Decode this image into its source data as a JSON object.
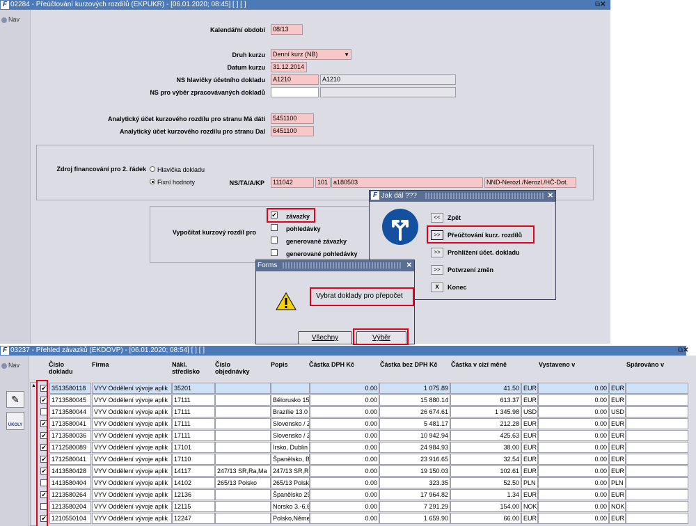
{
  "top_window": {
    "title": "02284 - Přeúčtování kurzových rozdílů (EKPUKR) - [06.01.2020; 08:45]  [ ]  [ ]",
    "nav": "Nav",
    "fields": {
      "kalendarni_obdobi_label": "Kalendářní období",
      "kalendarni_obdobi": "08/13",
      "druh_kurzu_label": "Druh kurzu",
      "druh_kurzu": "Denní kurz (NB)",
      "datum_kurzu_label": "Datum kurzu",
      "datum_kurzu": "31.12.2014",
      "ns_hlavicky_label": "NS hlavičky účetního dokladu",
      "ns_hlavicky_code": "A1210",
      "ns_hlavicky_name": "A1210",
      "ns_vyber_label": "NS pro výběr zpracovávaných dokladů",
      "ns_vyber_code": "",
      "ns_vyber_name": "",
      "ucet_ma_dati_label": "Analytický účet kurzového rozdílu pro stranu Má dáti",
      "ucet_ma_dati": "5451100",
      "ucet_dal_label": "Analytický účet kurzového rozdílu pro stranu Dal",
      "ucet_dal": "6451100"
    },
    "zdroj": {
      "label": "Zdroj financování pro 2. řádek",
      "opt_hlavicka": "Hlavička dokladu",
      "opt_fixni": "Fixní hodnoty",
      "ns_label": "NS/TA/A/KP",
      "ns": "111042",
      "ta": "101",
      "a": "a180503",
      "kp": "NND-Nerozl./Nerozl./HČ-Dot."
    },
    "vypocitat": {
      "label": "Vypočítat kurzový rozdíl pro",
      "options": [
        {
          "label": "závazky",
          "checked": true
        },
        {
          "label": "pohledávky",
          "checked": false
        },
        {
          "label": "generované závazky",
          "checked": false
        },
        {
          "label": "generované pohledávky",
          "checked": false
        }
      ]
    }
  },
  "jak_dal": {
    "title": "Jak dál ???",
    "items": [
      {
        "btn": "<<",
        "label": "Zpět"
      },
      {
        "btn": ">>",
        "label": "Přeúčtování kurz. rozdílů"
      },
      {
        "btn": ">>",
        "label": "Prohlížení účet. dokladu"
      },
      {
        "btn": ">>",
        "label": "Potvrzení změn"
      },
      {
        "btn": "X",
        "label": "Konec"
      }
    ]
  },
  "forms_dialog": {
    "title": "Forms",
    "message": "Vybrat doklady pro přepočet",
    "btn_vsechny": "Všechny",
    "btn_vyber": "Výběr"
  },
  "bottom_window": {
    "title": "03237 - Přehled závazků (EKDOVP) - [06.01.2020; 08:54]  [ ]  [ ]",
    "nav": "Nav",
    "side_icon_label": "ÚKOLY",
    "columns": {
      "cislo_dokladu": "Číslo\ndokladu",
      "firma": "Firma",
      "nakl_stredisko": "Nákl.\nstředisko",
      "cislo_objednavky": "Číslo\nobjednávky",
      "popis": "Popis",
      "castka_dph": "Částka DPH Kč",
      "castka_bez_dph": "Částka bez DPH Kč",
      "castka_mena": "Částka v cizí měně",
      "vystaveno": "Vystaveno v",
      "sparovano": "Spárováno v"
    },
    "rows": [
      {
        "checked": true,
        "doklad": "3513580118",
        "firma": "VYV Oddělení vývoje aplik",
        "str": "35201",
        "obj": "",
        "popis": "",
        "dph": "0.00",
        "bez": "1 075.89",
        "mena": "41.50",
        "cur": "EUR",
        "vyst": "0.00",
        "cur2": "EUR"
      },
      {
        "checked": true,
        "doklad": "1713580045",
        "firma": "VYV Oddělení vývoje aplik",
        "str": "17111",
        "obj": "",
        "popis": "Bělorusko 15",
        "dph": "0.00",
        "bez": "15 880.14",
        "mena": "613.37",
        "cur": "EUR",
        "vyst": "0.00",
        "cur2": "EUR"
      },
      {
        "checked": false,
        "doklad": "1713580044",
        "firma": "VYV Oddělení vývoje aplik",
        "str": "17111",
        "obj": "",
        "popis": "Brazílie 13.0",
        "dph": "0.00",
        "bez": "26 674.61",
        "mena": "1 345.98",
        "cur": "USD",
        "vyst": "0.00",
        "cur2": "USD"
      },
      {
        "checked": true,
        "doklad": "1713580041",
        "firma": "VYV Oddělení vývoje aplik",
        "str": "17111",
        "obj": "",
        "popis": "Slovensko / Z",
        "dph": "0.00",
        "bez": "5 481.17",
        "mena": "212.28",
        "cur": "EUR",
        "vyst": "0.00",
        "cur2": "EUR"
      },
      {
        "checked": true,
        "doklad": "1713580036",
        "firma": "VYV Oddělení vývoje aplik",
        "str": "17111",
        "obj": "",
        "popis": "Slovensko / Z",
        "dph": "0.00",
        "bez": "10 942.94",
        "mena": "425.63",
        "cur": "EUR",
        "vyst": "0.00",
        "cur2": "EUR"
      },
      {
        "checked": true,
        "doklad": "1712580089",
        "firma": "VYV Oddělení vývoje aplik",
        "str": "17101",
        "obj": "",
        "popis": "Irsko, Dublin",
        "dph": "0.00",
        "bez": "24 984.93",
        "mena": "38.00",
        "cur": "EUR",
        "vyst": "0.00",
        "cur2": "EUR"
      },
      {
        "checked": true,
        "doklad": "1712580041",
        "firma": "VYV Oddělení vývoje aplik",
        "str": "17110",
        "obj": "",
        "popis": "Španělsko, B",
        "dph": "0.00",
        "bez": "23 916.65",
        "mena": "32.54",
        "cur": "EUR",
        "vyst": "0.00",
        "cur2": "EUR"
      },
      {
        "checked": true,
        "doklad": "1413580428",
        "firma": "VYV Oddělení vývoje aplik",
        "str": "14117",
        "obj": "247/13 SR,Ra,Ma",
        "popis": "247/13 SR,Ra",
        "dph": "0.00",
        "bez": "19 150.03",
        "mena": "102.61",
        "cur": "EUR",
        "vyst": "0.00",
        "cur2": "EUR"
      },
      {
        "checked": false,
        "doklad": "1413580404",
        "firma": "VYV Oddělení vývoje aplik",
        "str": "14102",
        "obj": "265/13 Polsko",
        "popis": "265/13 Polsk",
        "dph": "0.00",
        "bez": "323.35",
        "mena": "52.50",
        "cur": "PLN",
        "vyst": "0.00",
        "cur2": "PLN"
      },
      {
        "checked": true,
        "doklad": "1213580264",
        "firma": "VYV Oddělení vývoje aplik",
        "str": "12136",
        "obj": "",
        "popis": "Španělsko 29",
        "dph": "0.00",
        "bez": "17 964.82",
        "mena": "1.34",
        "cur": "EUR",
        "vyst": "0.00",
        "cur2": "EUR"
      },
      {
        "checked": false,
        "doklad": "1213580204",
        "firma": "VYV Oddělení vývoje aplik",
        "str": "12115",
        "obj": "",
        "popis": "Norsko 3.-6.6",
        "dph": "0.00",
        "bez": "7 291.29",
        "mena": "154.00",
        "cur": "NOK",
        "vyst": "0.00",
        "cur2": "NOK"
      },
      {
        "checked": true,
        "doklad": "1210550104",
        "firma": "VYV Oddělení vývoje aplik",
        "str": "12247",
        "obj": "",
        "popis": "Polsko,Němec",
        "dph": "0.00",
        "bez": "1 659.90",
        "mena": "66.00",
        "cur": "EUR",
        "vyst": "0.00",
        "cur2": "EUR"
      }
    ]
  },
  "colors": {
    "highlight": "#e3001b",
    "titlebar": "#4c79b8",
    "required_field": "#f8c8c8"
  }
}
